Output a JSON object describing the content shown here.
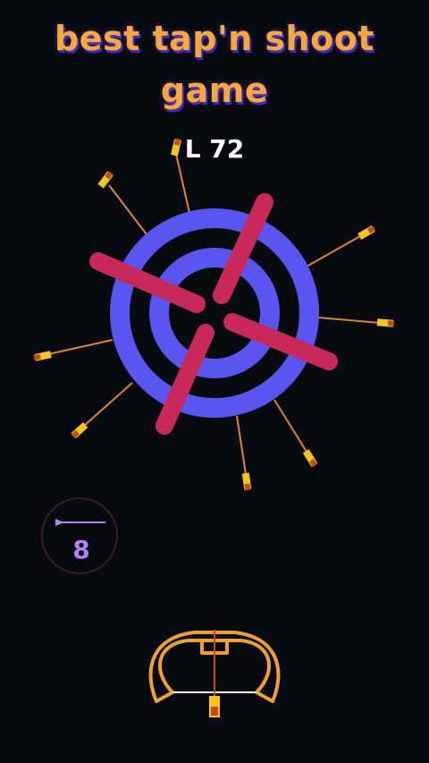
{
  "game": {
    "title_line1": "best tap'n shoot",
    "title_line2": "game",
    "level": "L 72",
    "arrows_remaining": "8"
  },
  "colors": {
    "title": "#f7a83a",
    "target_ring": "#5a55f0",
    "rotating_bar": "#c8285a",
    "arrow_shaft": "#e3822d",
    "bow": "#f0a030",
    "counter_text": "#b47ff5"
  },
  "icons": {
    "counter": "arrow-icon",
    "launcher": "bow-icon"
  }
}
